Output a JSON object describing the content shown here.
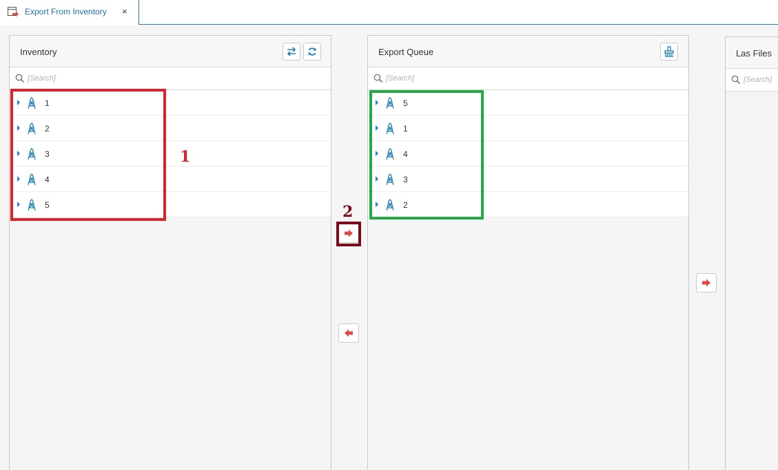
{
  "tab": {
    "label": "Export From Inventory",
    "close": "×"
  },
  "inventory": {
    "title": "Inventory",
    "search_placeholder": "[Search]",
    "items": [
      "1",
      "2",
      "3",
      "4",
      "5"
    ]
  },
  "export_queue": {
    "title": "Export Queue",
    "search_placeholder": "[Search]",
    "items": [
      "5",
      "1",
      "4",
      "3",
      "2"
    ]
  },
  "las_files": {
    "title": "Las Files",
    "search_placeholder": "[Search]"
  },
  "annotations": {
    "label1": "1",
    "label2": "2"
  },
  "colors": {
    "accent": "#1c7fb5",
    "annotation_red": "#e0202a",
    "annotation_green": "#22aa44",
    "annotation_dark": "#7a0a1a",
    "arrow_red": "#e04848"
  },
  "icons": {
    "tab": "export-window-icon",
    "swap": "swap-arrows-icon",
    "refresh": "refresh-icon",
    "clear": "broom-icon",
    "move_right": "arrow-right-icon",
    "move_left": "arrow-left-icon",
    "well": "oil-rig-icon",
    "search": "search-icon"
  }
}
